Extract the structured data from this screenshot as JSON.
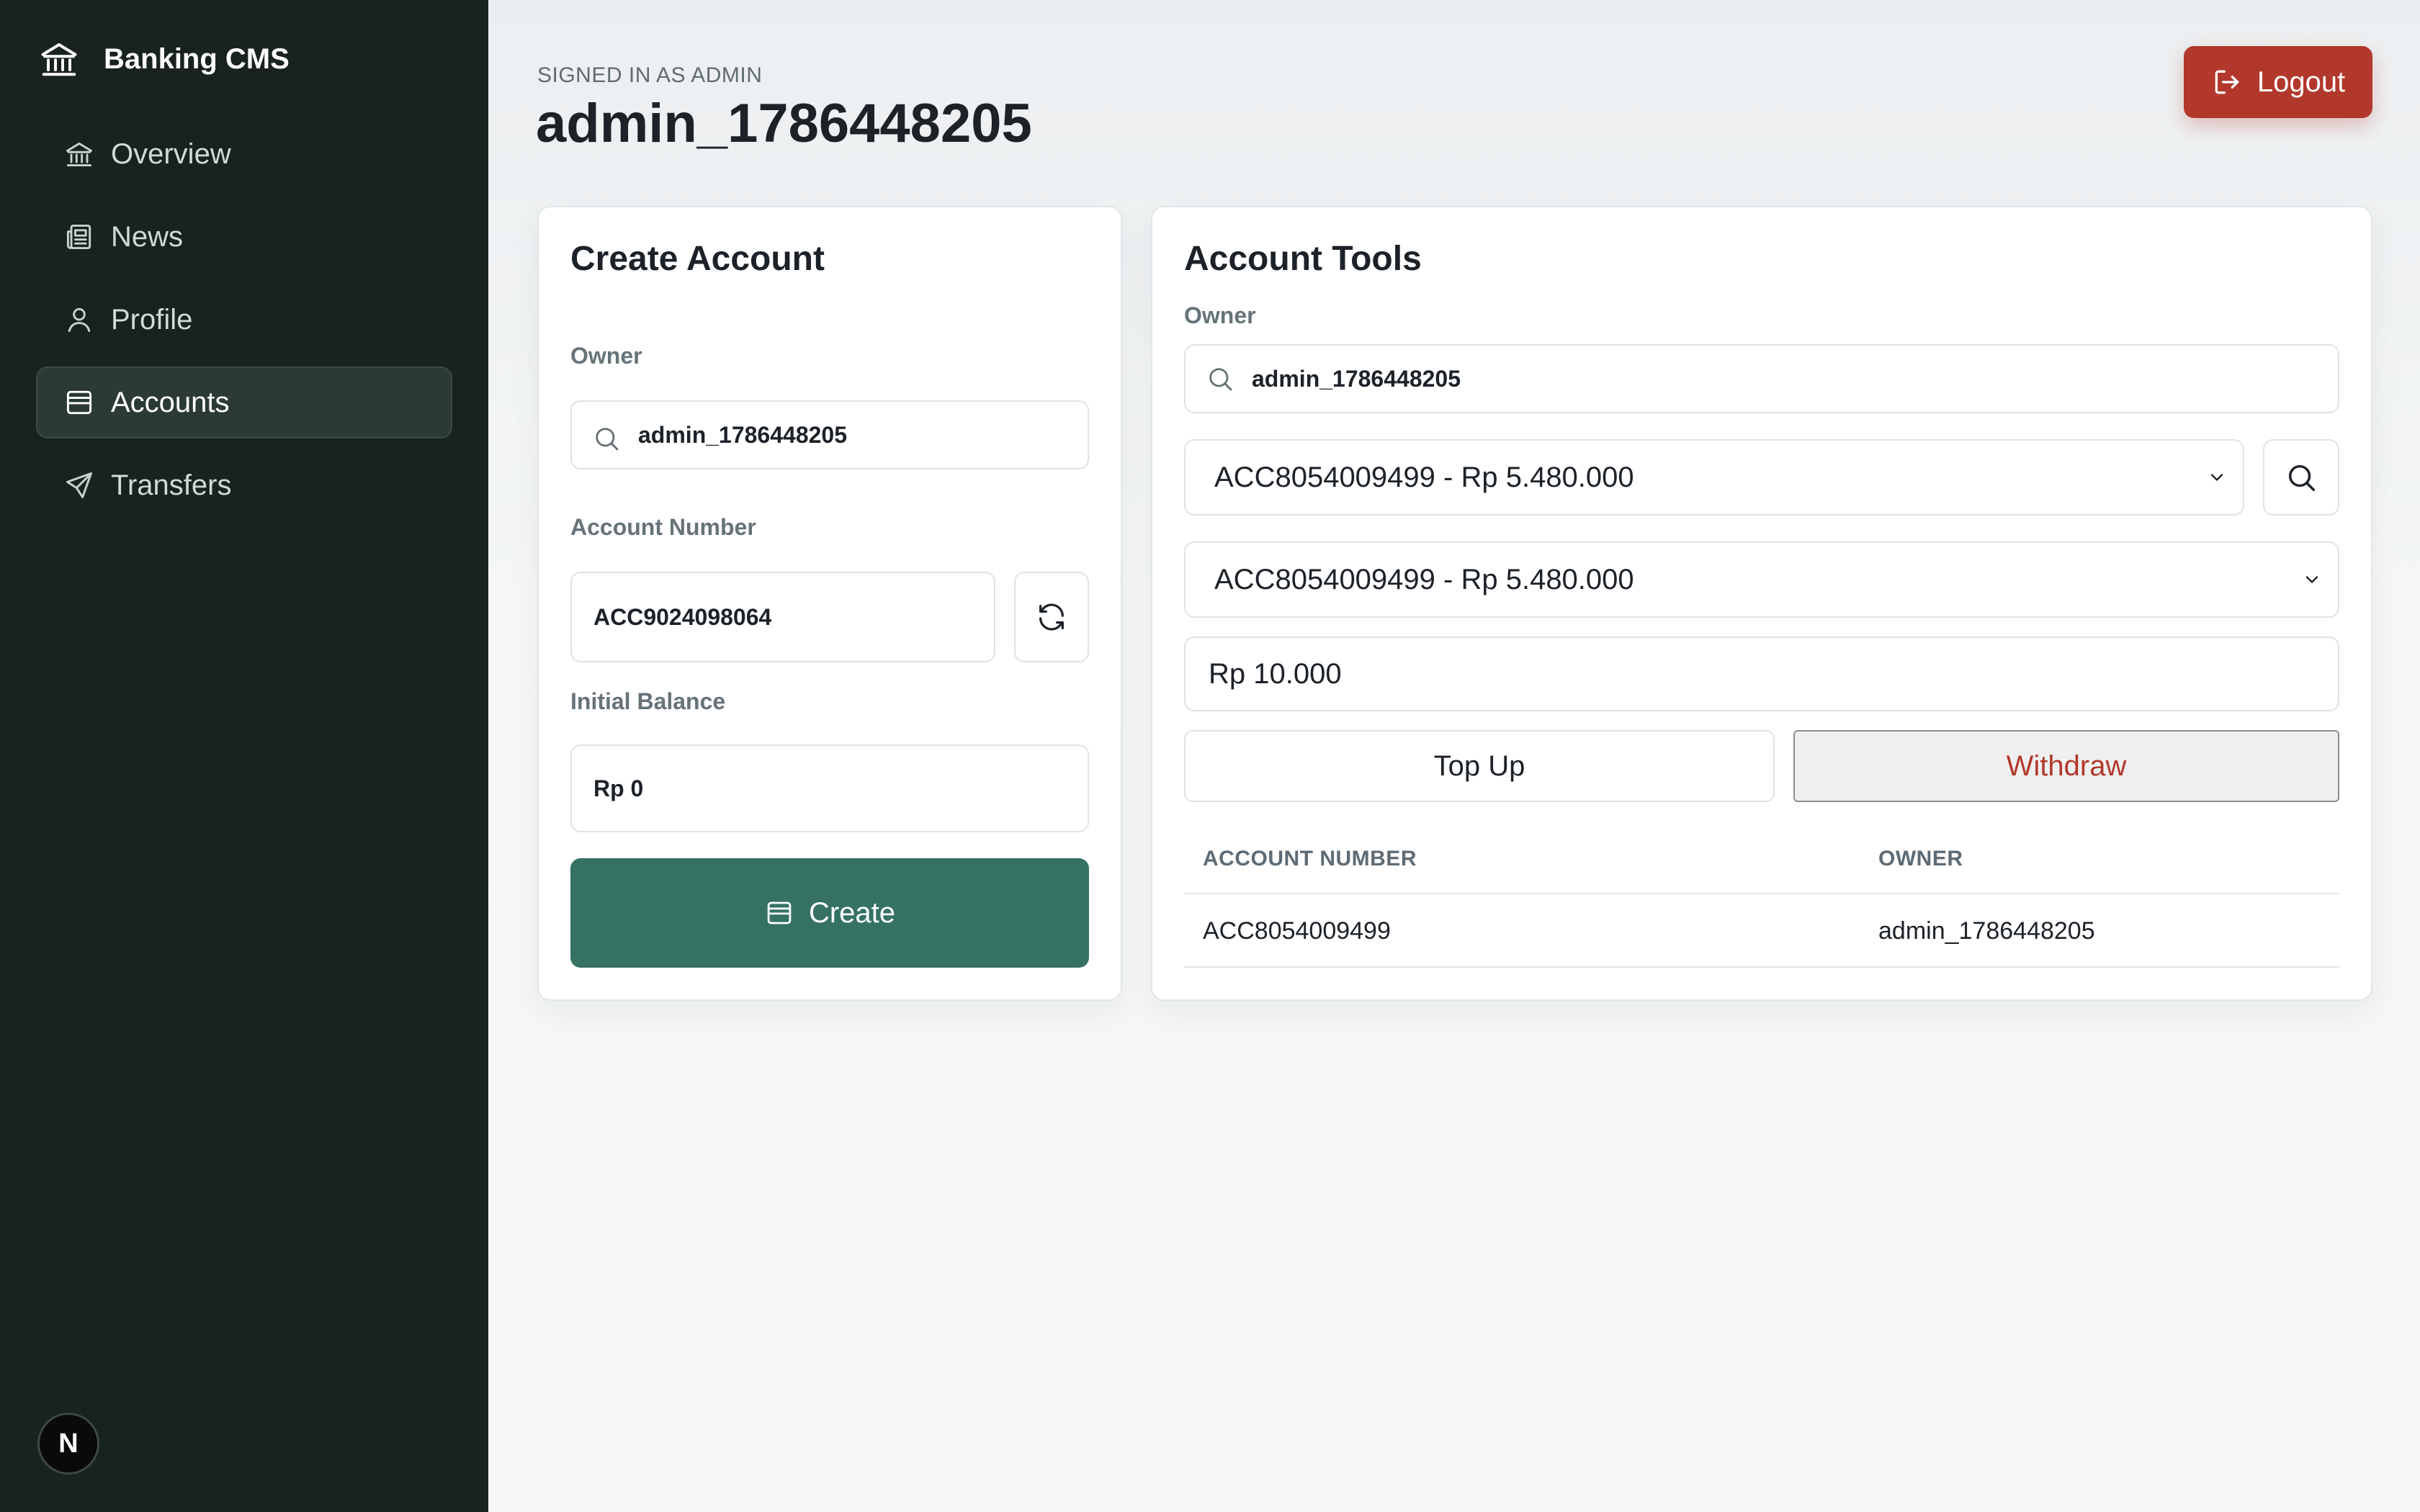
{
  "sidebar": {
    "brand": "Banking CMS",
    "items": [
      {
        "label": "Overview",
        "icon": "bank-icon",
        "active": false
      },
      {
        "label": "News",
        "icon": "newspaper-icon",
        "active": false
      },
      {
        "label": "Profile",
        "icon": "user-icon",
        "active": false
      },
      {
        "label": "Accounts",
        "icon": "wallet-icon",
        "active": true
      },
      {
        "label": "Transfers",
        "icon": "send-icon",
        "active": false
      }
    ],
    "badge": "N"
  },
  "header": {
    "signed_as": "SIGNED IN AS ADMIN",
    "username": "admin_1786448205",
    "logout_label": "Logout"
  },
  "create_account": {
    "title": "Create Account",
    "owner_label": "Owner",
    "owner_value": "admin_1786448205",
    "account_number_label": "Account Number",
    "account_number_value": "ACC9024098064",
    "initial_balance_label": "Initial Balance",
    "initial_balance_value": "Rp 0",
    "create_label": "Create"
  },
  "account_tools": {
    "title": "Account Tools",
    "owner_label": "Owner",
    "owner_value": "admin_1786448205",
    "account_select_1": "ACC8054009499 - Rp 5.480.000",
    "account_select_2": "ACC8054009499 - Rp 5.480.000",
    "amount_value": "Rp 10.000",
    "topup_label": "Top Up",
    "withdraw_label": "Withdraw",
    "table": {
      "columns": [
        "ACCOUNT NUMBER",
        "OWNER"
      ],
      "rows": [
        {
          "account_number": "ACC8054009499",
          "owner": "admin_1786448205"
        }
      ]
    }
  },
  "colors": {
    "sidebar_bg": "#18221f",
    "primary": "#357264",
    "danger": "#b2382b"
  }
}
